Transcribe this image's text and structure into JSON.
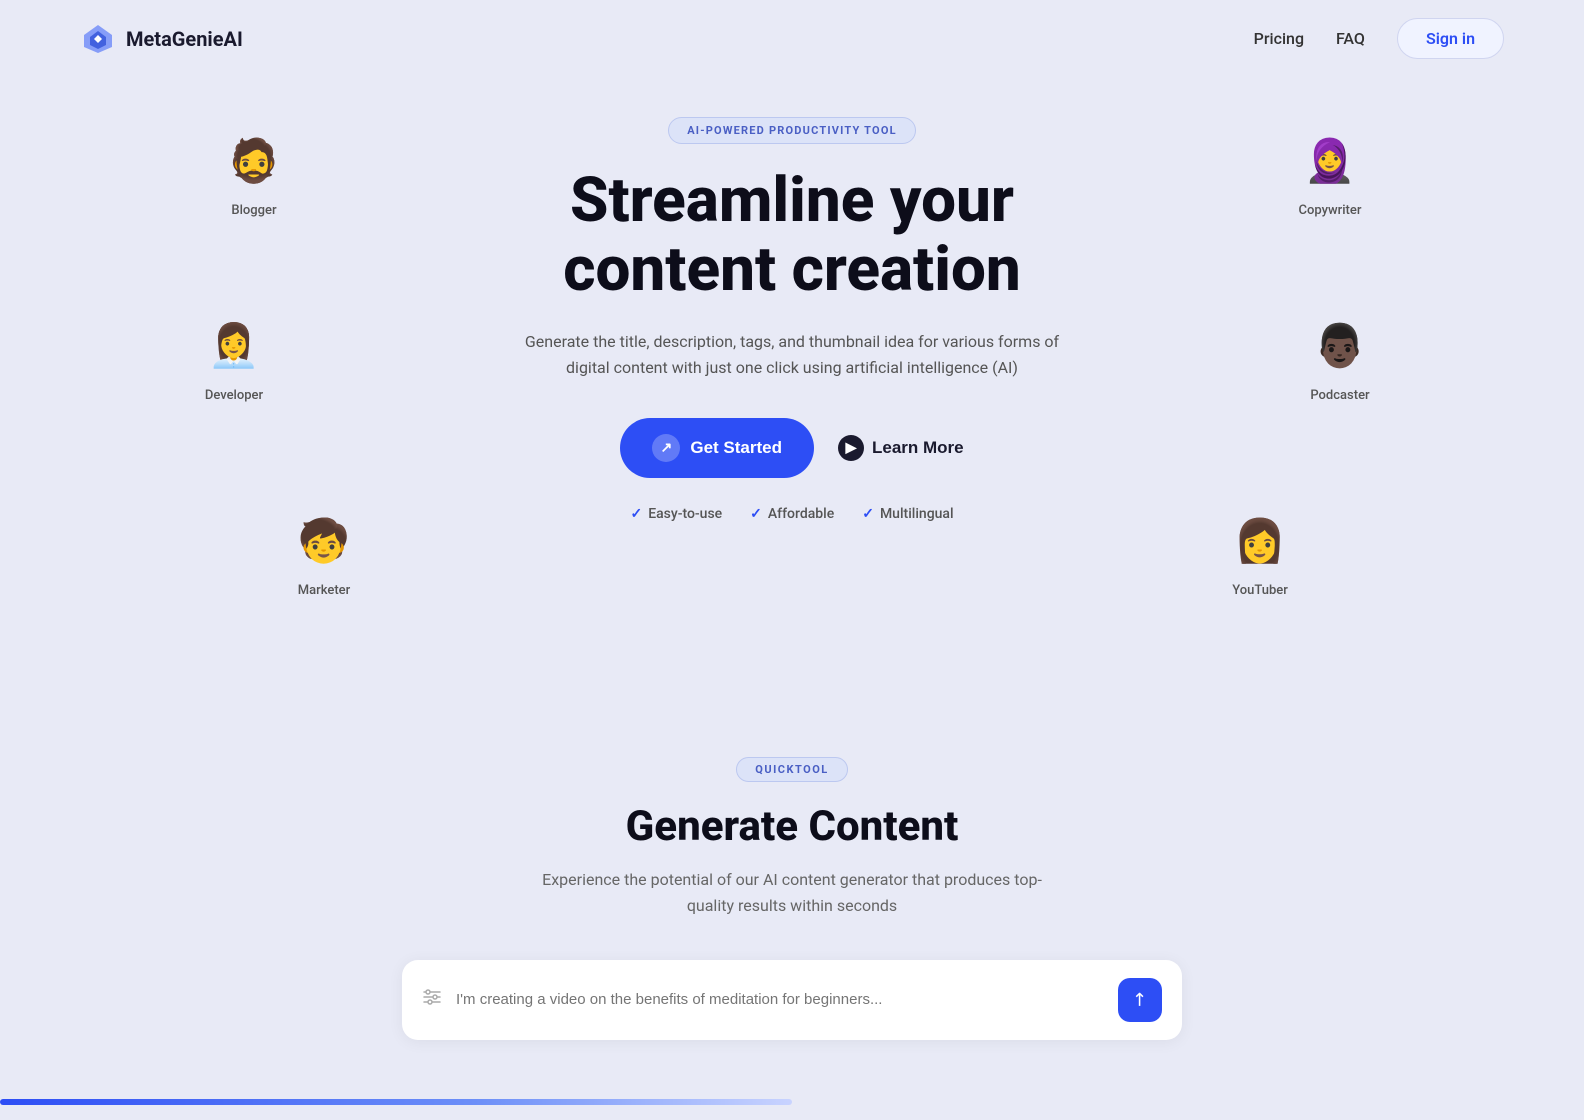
{
  "brand": {
    "name": "MetaGenieAI",
    "logo_emoji": "💎"
  },
  "nav": {
    "pricing": "Pricing",
    "faq": "FAQ",
    "signin": "Sign in"
  },
  "hero": {
    "badge": "AI-POWERED PRODUCTIVITY TOOL",
    "title_line1": "Streamline your",
    "title_line2": "content creation",
    "description": "Generate the title, description, tags, and thumbnail idea for various forms of digital content with just one click using artificial intelligence (AI)",
    "btn_get_started": "Get Started",
    "btn_learn_more": "Learn More",
    "feature1": "Easy-to-use",
    "feature2": "Affordable",
    "feature3": "Multilingual"
  },
  "avatars": {
    "blogger": {
      "label": "Blogger",
      "emoji": "🧔"
    },
    "developer": {
      "label": "Developer",
      "emoji": "👩‍💼"
    },
    "marketer": {
      "label": "Marketer",
      "emoji": "🧒"
    },
    "copywriter": {
      "label": "Copywriter",
      "emoji": "🧕"
    },
    "podcaster": {
      "label": "Podcaster",
      "emoji": "👨‍🦱"
    },
    "youtuber": {
      "label": "YouTuber",
      "emoji": "👩"
    }
  },
  "section2": {
    "badge": "QUICKTOOL",
    "title": "Generate Content",
    "description": "Experience the potential of our AI content generator that produces top-quality results within seconds",
    "input_placeholder": "I'm creating a video on the benefits of meditation for beginners..."
  }
}
